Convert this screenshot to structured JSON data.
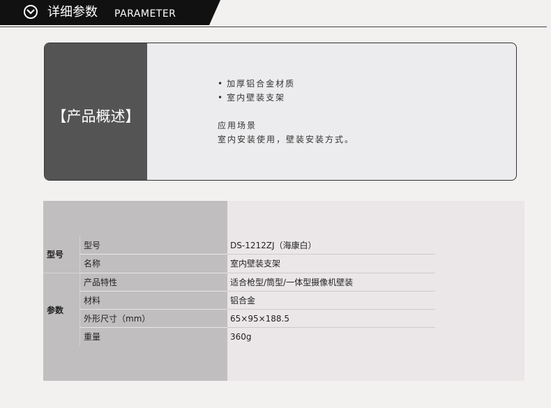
{
  "header": {
    "title": "详细参数",
    "subtitle": "PARAMETER",
    "icon": "chevron-down-circle-icon"
  },
  "overview": {
    "title": "【产品概述】",
    "features": [
      "加厚铝合金材质",
      "室内壁装支架"
    ],
    "scene_title": "应用场景",
    "scene_text": "室内安装使用，壁装安装方式。"
  },
  "params": {
    "groups": [
      {
        "label": "型号",
        "rows": [
          {
            "key": "型号",
            "value": "DS-1212ZJ（海康白）"
          },
          {
            "key": "名称",
            "value": "室内壁装支架"
          }
        ]
      },
      {
        "label": "参数",
        "rows": [
          {
            "key": "产品特性",
            "value": "适合枪型/筒型/一体型摄像机壁装"
          },
          {
            "key": "材料",
            "value": "铝合金"
          },
          {
            "key": "外形尺寸（mm）",
            "value": "65×95×188.5"
          },
          {
            "key": "重量",
            "value": "360g"
          }
        ]
      }
    ]
  }
}
